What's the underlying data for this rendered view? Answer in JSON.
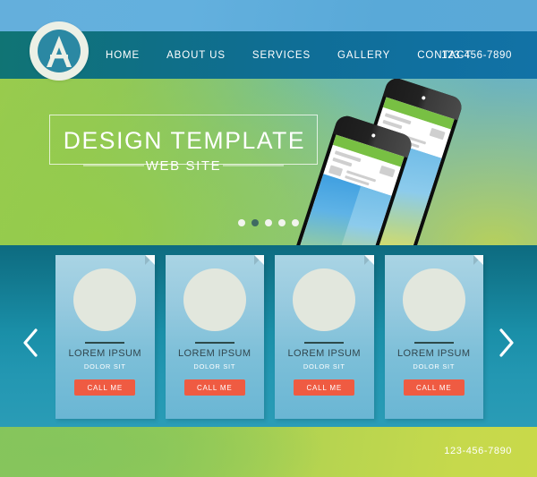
{
  "site": {
    "logo_icon": "letter-a-circle-logo"
  },
  "nav": {
    "items": [
      {
        "label": "HOME"
      },
      {
        "label": "ABOUT US"
      },
      {
        "label": "SERVICES"
      },
      {
        "label": "GALLERY"
      },
      {
        "label": "CONTACT"
      }
    ],
    "phone": "123-456-7890"
  },
  "hero": {
    "title": "DESIGN TEMPLATE",
    "subtitle": "WEB SITE",
    "carousel": {
      "dot_count": 5,
      "active_index": 1
    },
    "device_mockup_icon": "two-smartphones-mockup"
  },
  "cards_section": {
    "prev_arrow_icon": "chevron-left-icon",
    "next_arrow_icon": "chevron-right-icon",
    "cards": [
      {
        "avatar_icon": "circle-avatar-placeholder",
        "title": "LOREM IPSUM",
        "subtitle": "DOLOR SIT",
        "button_label": "CALL ME"
      },
      {
        "avatar_icon": "circle-avatar-placeholder",
        "title": "LOREM IPSUM",
        "subtitle": "DOLOR SIT",
        "button_label": "CALL ME"
      },
      {
        "avatar_icon": "circle-avatar-placeholder",
        "title": "LOREM IPSUM",
        "subtitle": "DOLOR SIT",
        "button_label": "CALL ME"
      },
      {
        "avatar_icon": "circle-avatar-placeholder",
        "title": "LOREM IPSUM",
        "subtitle": "DOLOR SIT",
        "button_label": "CALL ME"
      }
    ]
  },
  "footer": {
    "phone": "123-456-7890"
  },
  "colors": {
    "nav_bar_start": "#107474",
    "nav_bar_end": "#1272a6",
    "hero_green": "#9acb4e",
    "hero_blue": "#59ade0",
    "cards_section_top": "#0d6b80",
    "cards_section_bottom": "#2a9cb6",
    "card_bg_top": "#a9d4e4",
    "card_bg_bottom": "#6ab6d4",
    "card_title": "#31474f",
    "cta_button": "#ef5b42",
    "footer_green": "#86c55c",
    "footer_yellow_green": "#c9d94a",
    "dot_active": "#3f6a62",
    "dot_inactive": "#f2f4ee",
    "logo_ring": "#ecf0e6",
    "logo_mark": "#2b88a3",
    "phone_green_bar": "#78c043"
  }
}
